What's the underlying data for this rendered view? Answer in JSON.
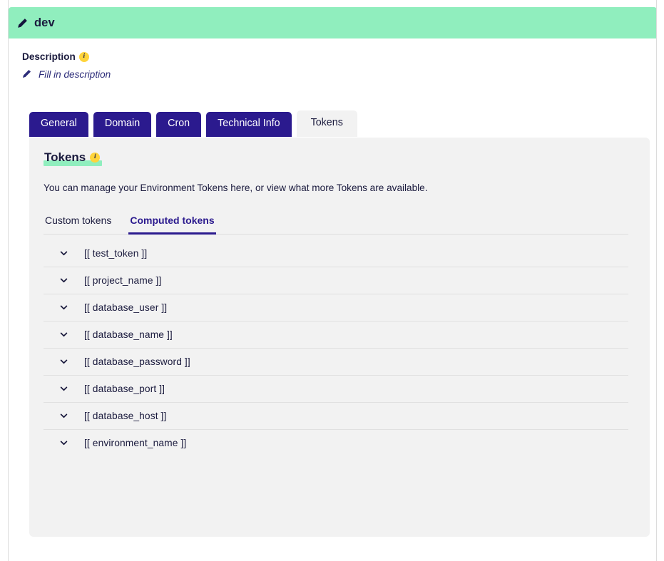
{
  "env": {
    "title": "dev",
    "edit_icon": "pencil-icon"
  },
  "description": {
    "label": "Description",
    "info_icon": "info-icon",
    "info_glyph": "i",
    "placeholder_link": "Fill in description",
    "edit_icon": "pencil-icon"
  },
  "tabs": [
    {
      "label": "General",
      "active": false
    },
    {
      "label": "Domain",
      "active": false
    },
    {
      "label": "Cron",
      "active": false
    },
    {
      "label": "Technical Info",
      "active": false
    },
    {
      "label": "Tokens",
      "active": true
    }
  ],
  "panel": {
    "title": "Tokens",
    "info_glyph": "i",
    "description": "You can manage your Environment Tokens here, or view what more Tokens are available.",
    "subtabs": [
      {
        "label": "Custom tokens",
        "active": false
      },
      {
        "label": "Computed tokens",
        "active": true
      }
    ],
    "tokens": [
      {
        "name": "[[ test_token ]]"
      },
      {
        "name": "[[ project_name ]]"
      },
      {
        "name": "[[ database_user ]]"
      },
      {
        "name": "[[ database_name ]]"
      },
      {
        "name": "[[ database_password ]]"
      },
      {
        "name": "[[ database_port ]]"
      },
      {
        "name": "[[ database_host ]]"
      },
      {
        "name": "[[ environment_name ]]"
      }
    ]
  },
  "colors": {
    "header_green": "#90eebe",
    "tab_purple": "#2b1a8e",
    "panel_gray": "#f2f2f2",
    "info_yellow": "#ffd43b",
    "text_dark": "#1a1a3d"
  }
}
